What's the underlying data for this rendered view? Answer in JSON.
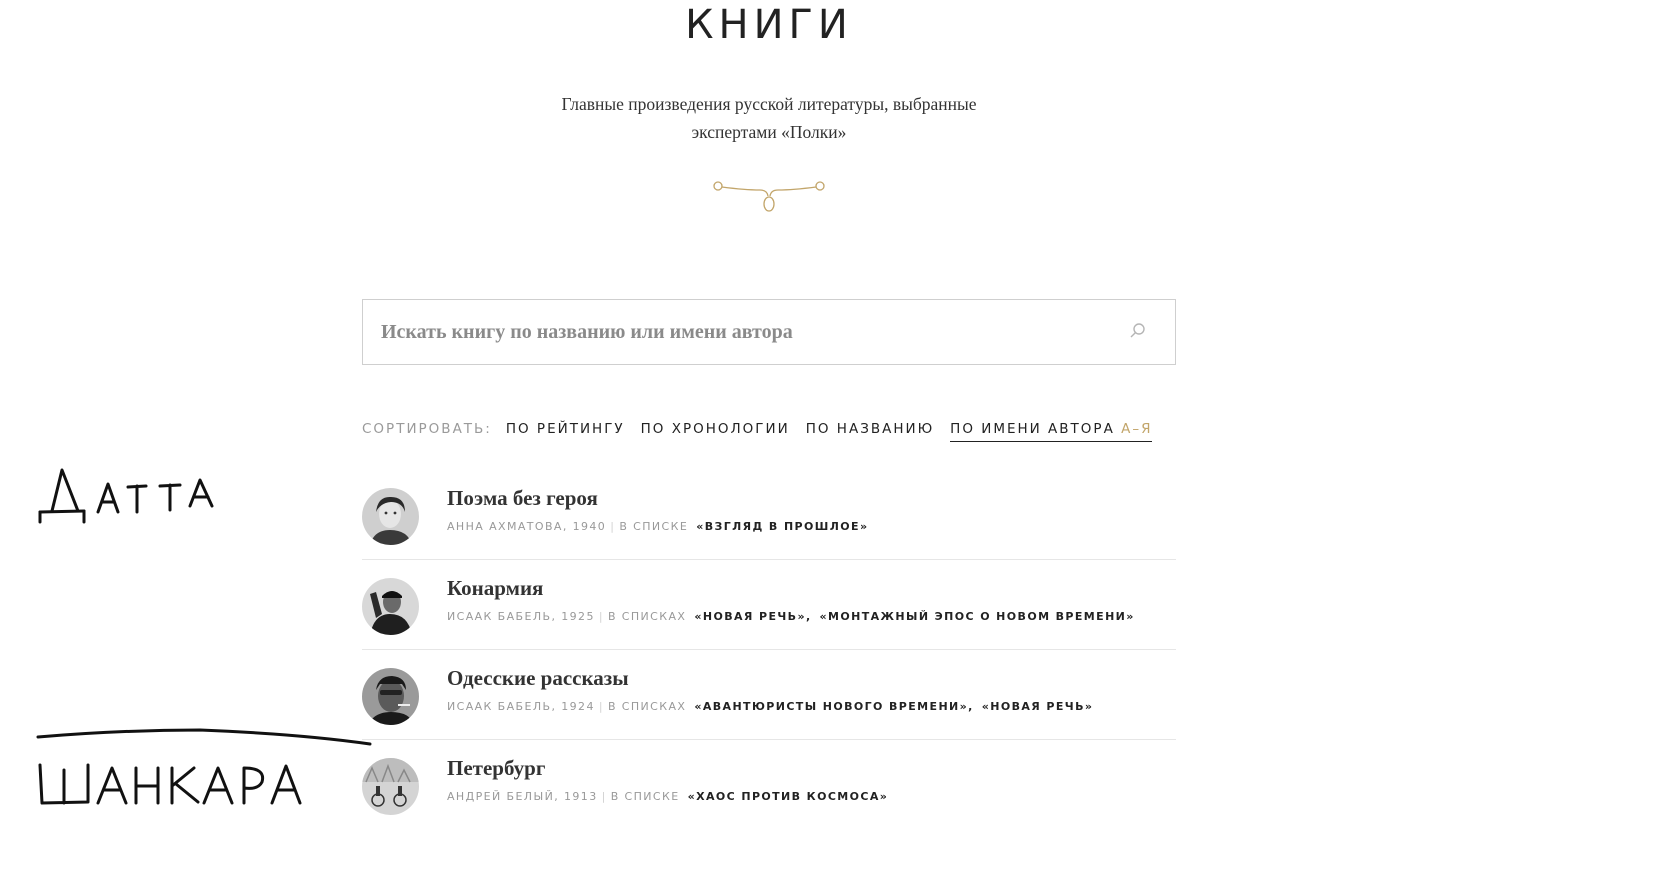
{
  "header": {
    "title": "КНИГИ",
    "subtitle_line1": "Главные произведения русской литературы, выбранные",
    "subtitle_line2": "экспертами «Полки»"
  },
  "search": {
    "placeholder": "Искать книгу по названию или имени автора",
    "icon": "search-icon"
  },
  "sort": {
    "label": "СОРТИРОВАТЬ:",
    "options": [
      "ПО РЕЙТИНГУ",
      "ПО ХРОНОЛОГИИ",
      "ПО НАЗВАНИЮ",
      "ПО ИМЕНИ АВТОРА"
    ],
    "active_direction": "А–Я",
    "accent_color": "#c2a56a"
  },
  "books": [
    {
      "title": "Поэма без героя",
      "author_year": "АННА АХМАТОВА, 1940",
      "lists_label": "В СПИСКЕ",
      "lists": [
        "«ВЗГЛЯД В ПРОШЛОЕ»"
      ]
    },
    {
      "title": "Конармия",
      "author_year": "ИСААК БАБЕЛЬ, 1925",
      "lists_label": "В СПИСКАХ",
      "lists": [
        "«НОВАЯ РЕЧЬ»,",
        "«МОНТАЖНЫЙ ЭПОС О НОВОМ ВРЕМЕНИ»"
      ]
    },
    {
      "title": "Одесские рассказы",
      "author_year": "ИСААК БАБЕЛЬ, 1924",
      "lists_label": "В СПИСКАХ",
      "lists": [
        "«АВАНТЮРИСТЫ НОВОГО ВРЕМЕНИ»,",
        "«НОВАЯ РЕЧЬ»"
      ]
    },
    {
      "title": "Петербург",
      "author_year": "АНДРЕЙ БЕЛЫЙ, 1913",
      "lists_label": "В СПИСКЕ",
      "lists": [
        "«ХАОС ПРОТИВ КОСМОСА»"
      ]
    }
  ],
  "annotations": {
    "note_top": "ДАТТА",
    "note_bottom": "ШАНКАРА"
  }
}
